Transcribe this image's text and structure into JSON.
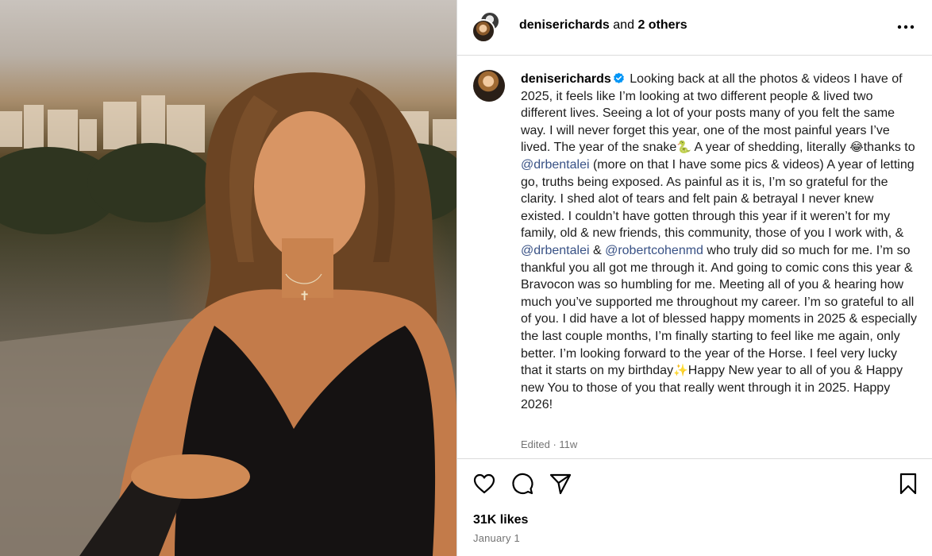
{
  "post": {
    "header": {
      "username": "deniserichards",
      "and_text": "and",
      "others": "2 others"
    },
    "caption": {
      "username": "deniserichards",
      "p1": "Looking back at all the photos & videos I have of 2025, it feels like I’m looking at two different people & lived two different lives. Seeing a lot of your posts many of you felt the same way. I will never forget this year, one of the most painful years I’ve lived. The year of the snake",
      "emoji_snake": "🐍",
      "p2": " A year of shedding, literally ",
      "emoji_laugh": "😂",
      "p3": "thanks to ",
      "mention1": "@drbentalei",
      "p4": " (more on that I have some pics & videos) A year of letting go, truths being exposed. As painful as it is, I’m so grateful for the clarity. I shed alot of tears and felt pain & betrayal I never knew existed. I couldn’t have gotten through this year if it weren’t for my family, old & new friends, this community, those of you I work with, & ",
      "mention2": "@drbentalei",
      "p5": " & ",
      "mention3": "@robertcohenmd",
      "p6": " who truly did so much for me. I’m so thankful you all got me through it. And going to comic cons this year & Bravocon was so humbling for me. Meeting all of you & hearing how much you’ve supported me throughout my career. I’m so grateful to all of you. I did have a lot of blessed happy moments in 2025 & especially the last couple months, I’m finally starting to feel like me again, only better. I’m looking forward to the year of the Horse. I feel very lucky that it starts on my birthday",
      "emoji_sparkle": "✨",
      "p7": "Happy New year to all of you & Happy new You to those of you that really went through it in 2025. Happy 2026!"
    },
    "meta": "Edited · 11w",
    "likes": "31K likes",
    "date": "January 1"
  },
  "icons": {
    "more": "more-options-icon",
    "like": "heart-icon",
    "comment": "comment-icon",
    "share": "send-icon",
    "save": "bookmark-icon",
    "verified": "verified-badge-icon"
  },
  "colors": {
    "mention": "#385185",
    "verified": "#0095f6",
    "muted": "#737373",
    "border": "#dbdbdb"
  }
}
